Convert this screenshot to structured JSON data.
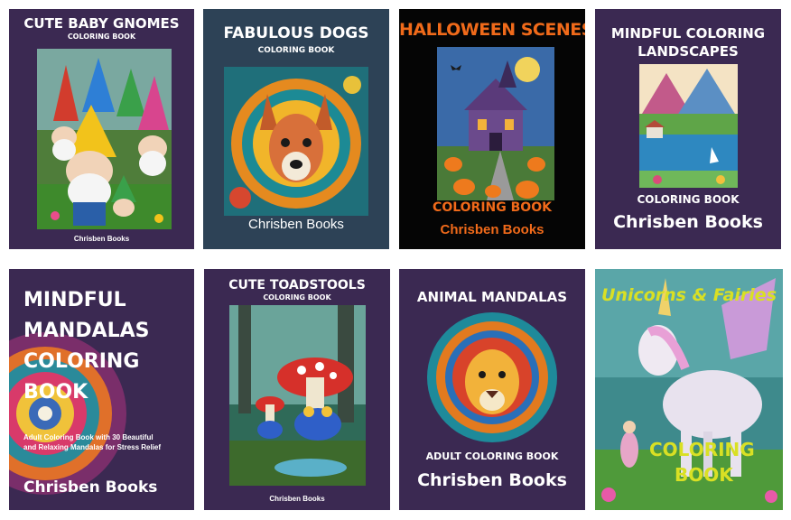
{
  "colors": {
    "purple": "#3b2952",
    "navy": "#2d4256",
    "black": "#050505",
    "halloween_orange": "#f06a1a",
    "unicorn_yellow": "#d9e024",
    "unicorn_pink": "#e85aa8"
  },
  "books": [
    {
      "title": "CUTE BABY GNOMES",
      "subtitle": "COLORING BOOK",
      "author": "Chrisben Books",
      "art_icon": "gnomes-illustration"
    },
    {
      "title": "FABULOUS DOGS",
      "subtitle": "COLORING BOOK",
      "author": "Chrisben Books",
      "art_icon": "dog-mandala-illustration"
    },
    {
      "title": "HALLOWEEN SCENES",
      "subtitle": "COLORING BOOK",
      "author": "Chrisben Books",
      "art_icon": "haunted-house-illustration"
    },
    {
      "title_line1": "MINDFUL COLORING",
      "title_line2": "LANDSCAPES",
      "subtitle": "COLORING BOOK",
      "author": "Chrisben Books",
      "art_icon": "landscape-illustration"
    },
    {
      "title_lines": [
        "MINDFUL",
        "MANDALAS",
        "COLORING",
        "BOOK"
      ],
      "description_line1": "Adult Coloring Book with 30 Beautiful",
      "description_line2": "and Relaxing Mandalas for Stress Relief",
      "author": "Chrisben Books",
      "art_icon": "mandala-illustration"
    },
    {
      "title": "CUTE TOADSTOOLS",
      "subtitle": "COLORING BOOK",
      "author": "Chrisben Books",
      "art_icon": "toadstool-frog-illustration"
    },
    {
      "title": "ANIMAL MANDALAS",
      "subtitle": "ADULT COLORING BOOK",
      "author": "Chrisben Books",
      "art_icon": "lion-mandala-illustration"
    },
    {
      "title": "Unicorns & Fairies",
      "subtitle_line1": "COLORING",
      "subtitle_line2": "BOOK",
      "art_icon": "unicorn-illustration"
    }
  ]
}
